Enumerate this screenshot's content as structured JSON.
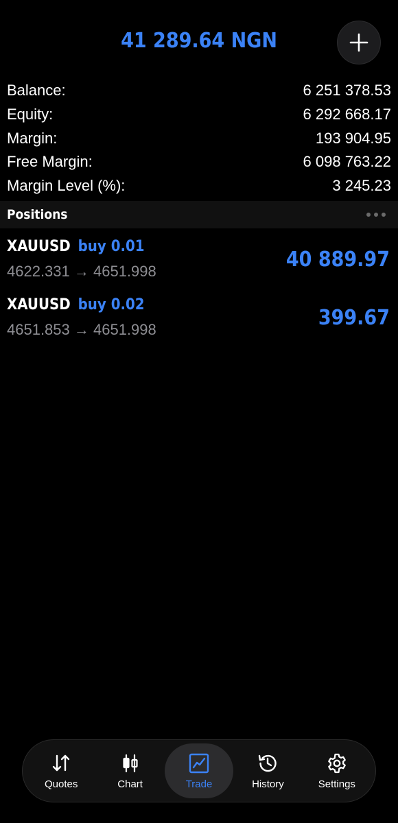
{
  "header": {
    "title": "41 289.64 NGN",
    "add_icon": "plus-icon"
  },
  "summary": {
    "rows": [
      {
        "label": "Balance:",
        "value": "6 251 378.53"
      },
      {
        "label": "Equity:",
        "value": "6 292 668.17"
      },
      {
        "label": "Margin:",
        "value": "193 904.95"
      },
      {
        "label": "Free Margin:",
        "value": "6 098 763.22"
      },
      {
        "label": "Margin Level (%):",
        "value": "3 245.23"
      }
    ]
  },
  "positions": {
    "title": "Positions",
    "items": [
      {
        "symbol": "XAUUSD",
        "type": "buy 0.01",
        "prices": "4622.331 → 4651.998",
        "profit": "40 889.97"
      },
      {
        "symbol": "XAUUSD",
        "type": "buy 0.02",
        "prices": "4651.853 → 4651.998",
        "profit": "399.67"
      }
    ]
  },
  "tabbar": {
    "tabs": [
      {
        "label": "Quotes",
        "icon": "quotes-arrows-icon"
      },
      {
        "label": "Chart",
        "icon": "candlestick-icon"
      },
      {
        "label": "Trade",
        "icon": "trade-chart-icon",
        "active": true
      },
      {
        "label": "History",
        "icon": "history-clock-icon"
      },
      {
        "label": "Settings",
        "icon": "gear-icon"
      }
    ]
  },
  "colors": {
    "accent": "#3b82f6",
    "background": "#000000",
    "secondary_text": "#8e8e93"
  }
}
